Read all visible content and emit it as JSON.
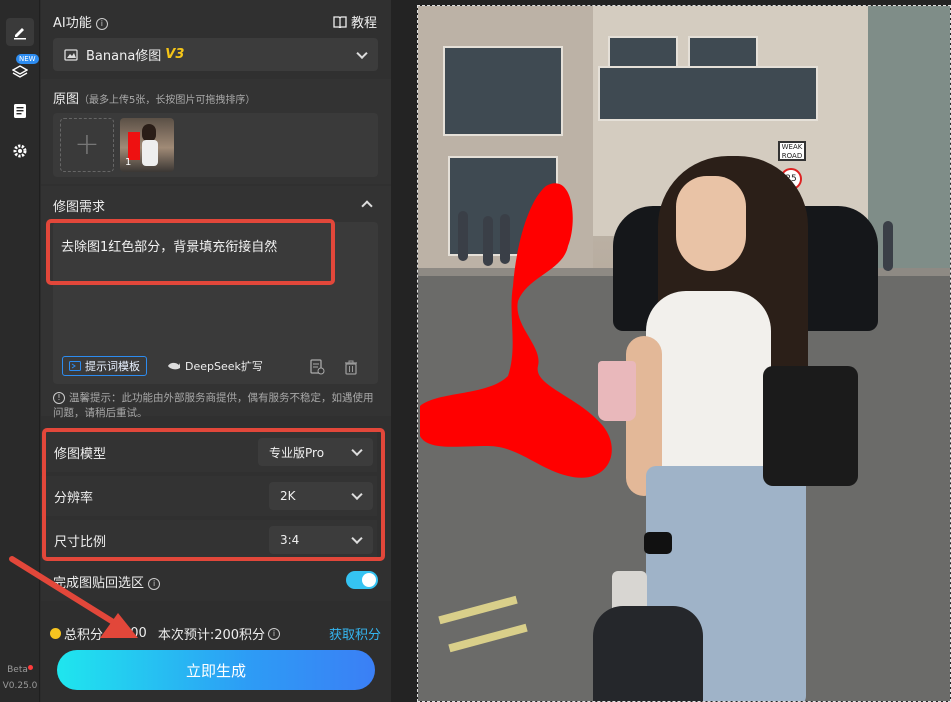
{
  "rail": {
    "new_badge": "NEW",
    "beta": "Beta",
    "version": "V0.25.0"
  },
  "panel": {
    "ai_title": "AI功能",
    "tutorial": "教程",
    "model_selector": {
      "name": "Banana修图",
      "version": "V3"
    },
    "original": {
      "title": "原图",
      "hint": "（最多上传5张，长按图片可拖拽排序）",
      "thumbs": [
        {
          "index": "1"
        }
      ]
    },
    "requirement": {
      "title": "修图需求",
      "text": "去除图1红色部分，背景填充衔接自然",
      "template_btn": "提示词模板",
      "deepseek_btn": "DeepSeek扩写"
    },
    "warning": "温馨提示：此功能由外部服务商提供，偶有服务不稳定，如遇使用问题，请稍后重试。",
    "options": [
      {
        "label": "修图模型",
        "value": "专业版Pro"
      },
      {
        "label": "分辨率",
        "value": "2K"
      },
      {
        "label": "尺寸比例",
        "value": "3:4"
      }
    ],
    "paste_back": {
      "label": "完成图贴回选区",
      "enabled": true
    },
    "points": {
      "total_label": "总积分",
      "total_value": "700",
      "estimate": "本次预计:200积分",
      "get_points": "获取积分"
    },
    "generate_btn": "立即生成"
  },
  "photo": {
    "signs": [
      "WEAK ROAD",
      "25"
    ]
  },
  "colors": {
    "accent": "#2d8cf0",
    "highlight": "#e2473a",
    "mask": "#ff0000",
    "toggle": "#35c3f2"
  }
}
